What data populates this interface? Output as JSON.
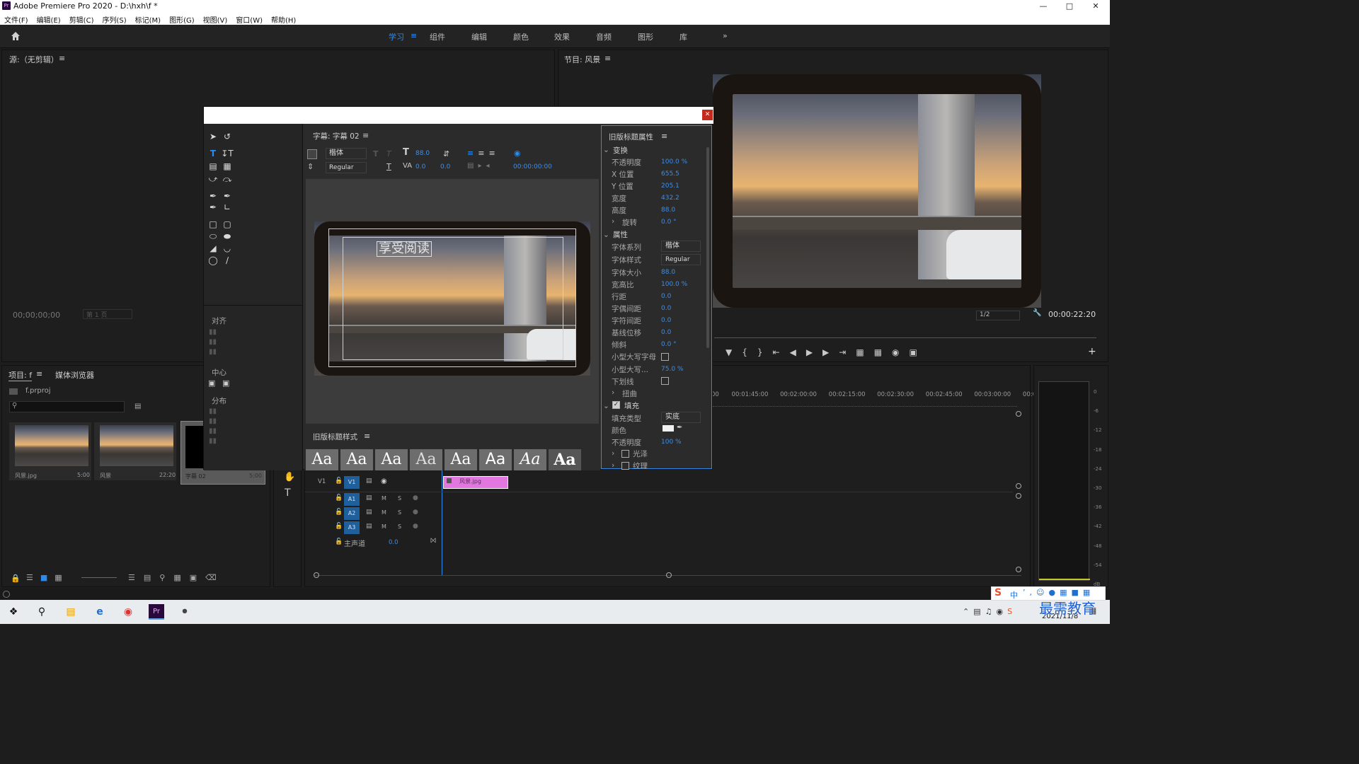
{
  "window": {
    "title": "Adobe Premiere Pro 2020 - D:\\hxh\\f *",
    "app_badge": "Pr"
  },
  "menu": [
    "文件(F)",
    "编辑(E)",
    "剪辑(C)",
    "序列(S)",
    "标记(M)",
    "图形(G)",
    "视图(V)",
    "窗口(W)",
    "帮助(H)"
  ],
  "workspaces": [
    "学习",
    "组件",
    "编辑",
    "颜色",
    "效果",
    "音频",
    "图形",
    "库"
  ],
  "source_panel": {
    "title": "源:（无剪辑）",
    "timecode": "00;00;00;00",
    "page": "第 1 页"
  },
  "program_panel": {
    "title": "节目: 风景",
    "zoom": "1/2",
    "timecode": "00:00:22:20"
  },
  "titler": {
    "panel_title": "字幕: 字幕 02",
    "font_family": "楷体",
    "font_style": "Regular",
    "font_size": "88.0",
    "kerning": "0.0",
    "leading": "0.0",
    "tab_time": "00:00:00:00",
    "canvas_text": "享受阅读",
    "styles_title": "旧版标题样式",
    "style_sample": "Aa"
  },
  "properties": {
    "title": "旧版标题属性",
    "sections": {
      "transform": "变换",
      "properties": "属性",
      "fill": "填充"
    },
    "rows": [
      {
        "label": "不透明度",
        "value": "100.0 %"
      },
      {
        "label": "X 位置",
        "value": "655.5"
      },
      {
        "label": "Y 位置",
        "value": "205.1"
      },
      {
        "label": "宽度",
        "value": "432.2"
      },
      {
        "label": "高度",
        "value": "88.0"
      },
      {
        "label": "旋转",
        "value": "0.0 °"
      }
    ],
    "prop_rows": [
      {
        "label": "字体系列",
        "value": "楷体"
      },
      {
        "label": "字体样式",
        "value": "Regular"
      },
      {
        "label": "字体大小",
        "value": "88.0"
      },
      {
        "label": "宽高比",
        "value": "100.0 %"
      },
      {
        "label": "行距",
        "value": "0.0"
      },
      {
        "label": "字偶间距",
        "value": "0.0"
      },
      {
        "label": "字符间距",
        "value": "0.0"
      },
      {
        "label": "基线位移",
        "value": "0.0"
      },
      {
        "label": "倾斜",
        "value": "0.0 °"
      },
      {
        "label": "小型大写字母",
        "value": ""
      },
      {
        "label": "小型大写...",
        "value": "75.0 %"
      },
      {
        "label": "下划线",
        "value": ""
      },
      {
        "label": "扭曲",
        "value": ""
      }
    ],
    "fill_rows": [
      {
        "label": "填充类型",
        "value": "实底"
      },
      {
        "label": "颜色",
        "value": ""
      },
      {
        "label": "不透明度",
        "value": "100 %"
      }
    ],
    "sheen": "光泽",
    "texture": "纹理"
  },
  "align_panel": {
    "align": "对齐",
    "center": "中心",
    "distribute": "分布"
  },
  "project_panel": {
    "tab_project": "项目: f",
    "tab_media": "媒体浏览器",
    "file": "f.prproj",
    "items": [
      {
        "name": "风景.jpg",
        "duration": "5:00"
      },
      {
        "name": "风景",
        "duration": "22:20"
      },
      {
        "name": "字幕 02",
        "duration": "5:00"
      }
    ]
  },
  "timeline": {
    "ruler": [
      "00",
      "00:01:45:00",
      "00:02:00:00",
      "00:02:15:00",
      "00:02:30:00",
      "00:02:45:00",
      "00:03:00:00",
      "00:03:15:"
    ],
    "tracks": [
      {
        "name": "V1",
        "tag": "V1"
      },
      {
        "name": "A1",
        "tag": "A1"
      },
      {
        "name": "A2",
        "tag": "A2"
      },
      {
        "name": "A3",
        "tag": "A3"
      }
    ],
    "master": "主声道",
    "master_value": "0.0",
    "clip": "风景.jpg",
    "m": "M",
    "s": "S"
  },
  "meter": {
    "labels": [
      "0",
      "-6",
      "-12",
      "-18",
      "-24",
      "-30",
      "-36",
      "-42",
      "-48",
      "-54",
      "dB"
    ]
  },
  "taskbar": {
    "date": "2021/11/8",
    "ime": "中"
  },
  "watermark": "最需教育",
  "colors": {
    "accent": "#2d8ceb",
    "clip": "#e377e0",
    "track_tag": "#1f5f9c"
  }
}
